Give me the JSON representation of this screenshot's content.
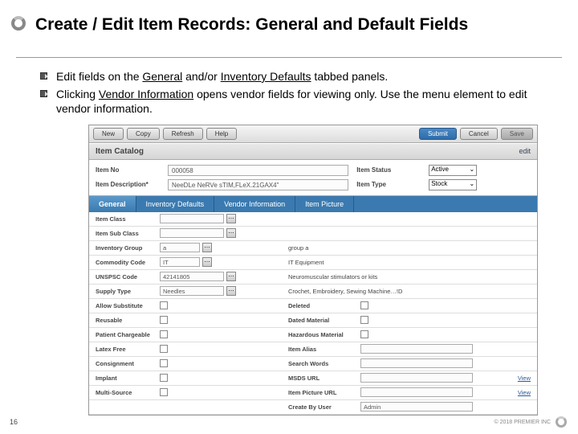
{
  "slide": {
    "title": "Create / Edit Item Records: General and Default Fields",
    "bullet1_pre": "Edit fields on the ",
    "bullet1_g": "General",
    "bullet1_mid": " and/or ",
    "bullet1_inv": "Inventory Defaults",
    "bullet1_post": " tabbed panels.",
    "bullet2_pre": "Clicking ",
    "bullet2_v": "Vendor Information",
    "bullet2_post": " opens vendor fields for viewing only. Use the menu  element to edit vendor information.",
    "page_number": "16",
    "copyright": "© 2018 PREMIER INC"
  },
  "app": {
    "toolbar": {
      "new": "New",
      "copy": "Copy",
      "refresh": "Refresh",
      "help": "Help",
      "submit": "Submit",
      "cancel": "Cancel",
      "save": "Save"
    },
    "panel_title": "Item Catalog",
    "edit": "edit",
    "header": {
      "item_no_label": "Item No",
      "item_no": "000058",
      "item_desc_label": "Item Description*",
      "item_desc": "NeeDLe NeRVe sTIM,FLeX.21GAX4\"",
      "item_status_label": "Item Status",
      "item_status": "Active",
      "item_type_label": "Item Type",
      "item_type": "Stock"
    },
    "tabs": {
      "general": "General",
      "inventory": "Inventory Defaults",
      "vendor": "Vendor Information",
      "picture": "Item Picture"
    },
    "rows": {
      "item_class": "Item Class",
      "item_class_v": "",
      "item_subclass": "Item Sub Class",
      "inventory_group": "Inventory Group",
      "inventory_group_v": "a",
      "inventory_group_d": "group a",
      "commodity": "Commodity Code",
      "commodity_v": "IT",
      "commodity_d": "IT Equipment",
      "unspsc": "UNSPSC Code",
      "unspsc_v": "42141805",
      "unspsc_d": "Neuromuscular stimulators or kits",
      "supply_type": "Supply Type",
      "supply_type_v": "Needles",
      "supply_type_d": "Crochet, Embroidery, Sewing Machine…!D",
      "allow_sub": "Allow Substitute",
      "deleted": "Deleted",
      "reusable": "Reusable",
      "dated": "Dated Material",
      "patient": "Patient Chargeable",
      "hazmat": "Hazardous Material",
      "latex": "Latex Free",
      "alias": "Item Alias",
      "consign": "Consignment",
      "search": "Search Words",
      "implant": "Implant",
      "msds": "MSDS URL",
      "view": "View",
      "multi": "Multi-Source",
      "picurl": "Item Picture URL",
      "createby": "Create By User",
      "createby_v": "Admin"
    }
  }
}
